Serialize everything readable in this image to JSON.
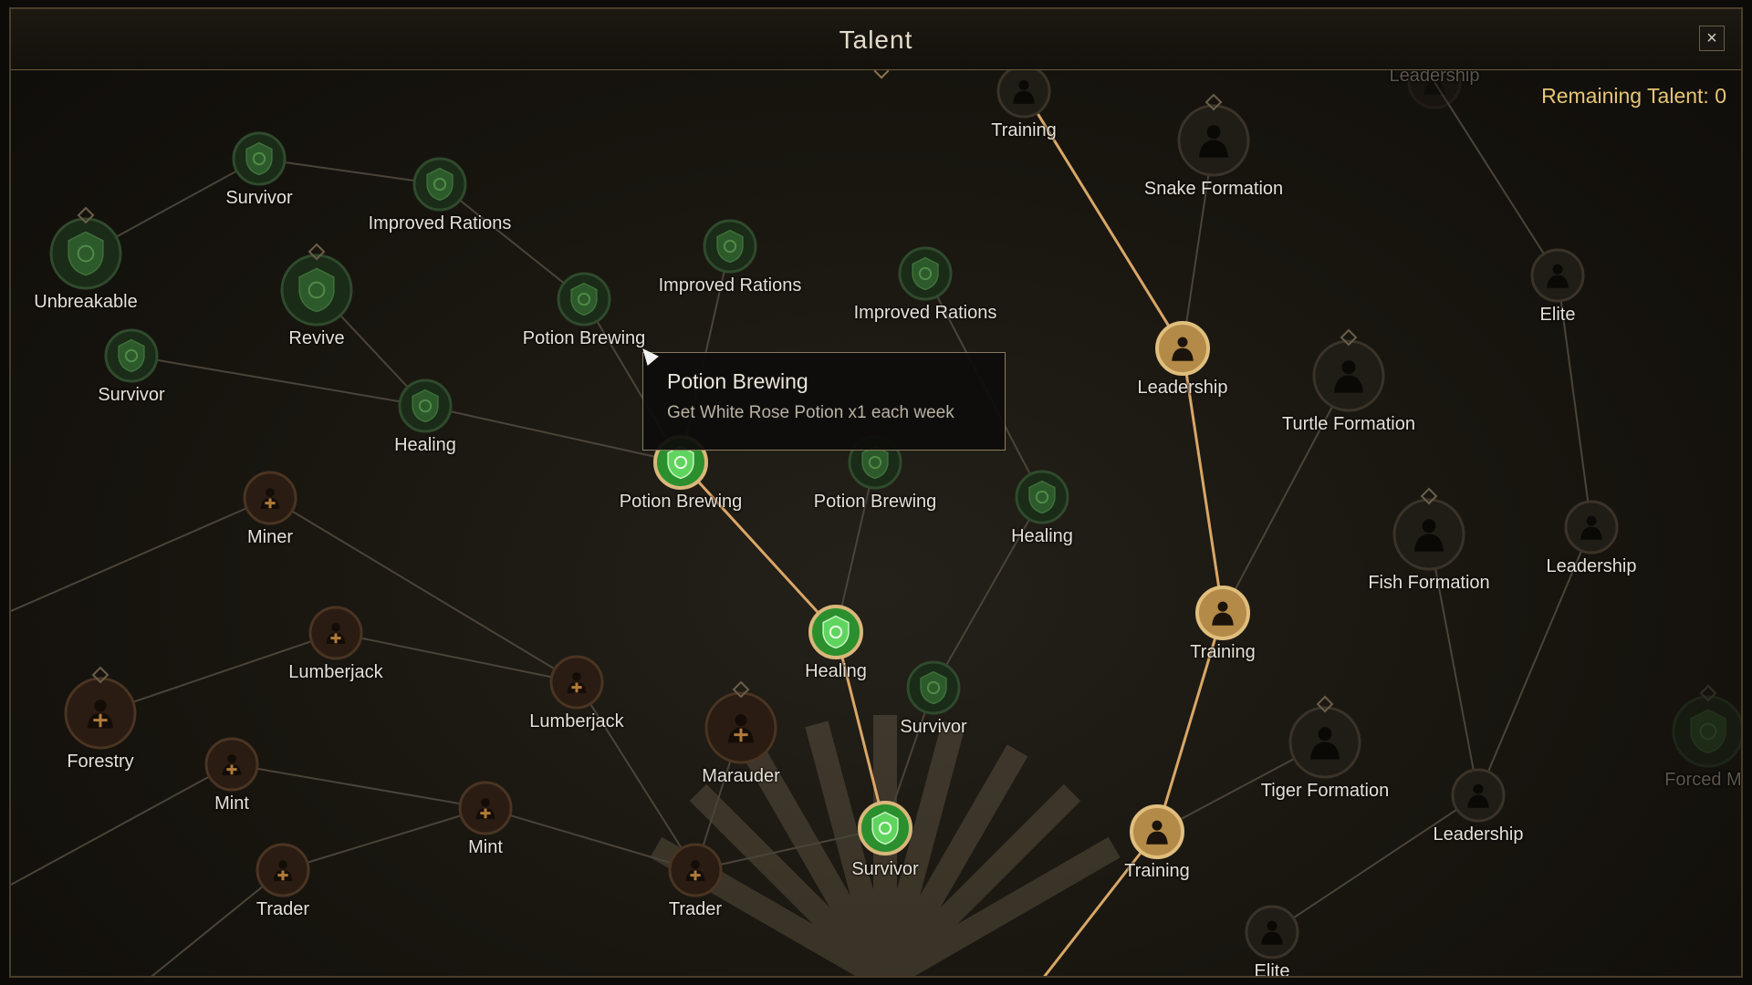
{
  "window": {
    "title": "Talent",
    "close_label": "×",
    "remaining_talent": "Remaining Talent: 0"
  },
  "tooltip": {
    "title": "Potion Brewing",
    "description": "Get White Rose Potion x1 each week"
  },
  "colors": {
    "active_path": "#d9a766",
    "inactive_path": "#4a4438",
    "shield_node": "#3aa83f",
    "figure_node_gold": "#c8a45e",
    "figure_node_bronze": "#6a4a2e"
  },
  "nodes": [
    {
      "id": "survivor-1",
      "label": "Survivor",
      "icon": "shield-icon",
      "state": "available"
    },
    {
      "id": "improved-rations-1",
      "label": "Improved Rations",
      "icon": "shield-icon",
      "state": "available"
    },
    {
      "id": "unbreakable",
      "label": "Unbreakable",
      "icon": "shield-icon",
      "state": "available"
    },
    {
      "id": "revive",
      "label": "Revive",
      "icon": "shield-icon",
      "state": "available"
    },
    {
      "id": "survivor-2",
      "label": "Survivor",
      "icon": "shield-icon",
      "state": "available"
    },
    {
      "id": "healing-1",
      "label": "Healing",
      "icon": "shield-icon",
      "state": "available"
    },
    {
      "id": "potion-brewing-1",
      "label": "Potion Brewing",
      "icon": "shield-icon",
      "state": "available"
    },
    {
      "id": "improved-rations-2",
      "label": "Improved Rations",
      "icon": "shield-icon",
      "state": "available"
    },
    {
      "id": "improved-rations-3",
      "label": "Improved Rations",
      "icon": "shield-icon",
      "state": "available"
    },
    {
      "id": "potion-brewing-2",
      "label": "Potion Brewing",
      "icon": "shield-icon",
      "state": "learned"
    },
    {
      "id": "potion-brewing-3",
      "label": "Potion Brewing",
      "icon": "shield-icon",
      "state": "available"
    },
    {
      "id": "healing-2",
      "label": "Healing",
      "icon": "shield-icon",
      "state": "available"
    },
    {
      "id": "healing-3",
      "label": "Healing",
      "icon": "shield-icon",
      "state": "learned"
    },
    {
      "id": "survivor-3",
      "label": "Survivor",
      "icon": "shield-icon",
      "state": "available"
    },
    {
      "id": "survivor-4",
      "label": "Survivor",
      "icon": "shield-icon",
      "state": "learned"
    },
    {
      "id": "miner",
      "label": "Miner",
      "icon": "worker-icon",
      "state": "available"
    },
    {
      "id": "lumberjack-1",
      "label": "Lumberjack",
      "icon": "worker-icon",
      "state": "available"
    },
    {
      "id": "lumberjack-2",
      "label": "Lumberjack",
      "icon": "worker-icon",
      "state": "available"
    },
    {
      "id": "forestry",
      "label": "Forestry",
      "icon": "worker-icon",
      "state": "available"
    },
    {
      "id": "mint-1",
      "label": "Mint",
      "icon": "worker-icon",
      "state": "available"
    },
    {
      "id": "mint-2",
      "label": "Mint",
      "icon": "worker-icon",
      "state": "available"
    },
    {
      "id": "marauder",
      "label": "Marauder",
      "icon": "worker-icon",
      "state": "available"
    },
    {
      "id": "trader-1",
      "label": "Trader",
      "icon": "worker-icon",
      "state": "available"
    },
    {
      "id": "trader-2",
      "label": "Trader",
      "icon": "worker-icon",
      "state": "available"
    },
    {
      "id": "training-1",
      "label": "Training",
      "icon": "soldier-icon",
      "state": "available"
    },
    {
      "id": "snake-formation",
      "label": "Snake Formation",
      "icon": "soldier-icon",
      "state": "available"
    },
    {
      "id": "leadership-1",
      "label": "Leadership",
      "icon": "soldier-icon",
      "state": "learned"
    },
    {
      "id": "turtle-formation",
      "label": "Turtle Formation",
      "icon": "soldier-icon",
      "state": "available"
    },
    {
      "id": "training-2",
      "label": "Training",
      "icon": "soldier-icon",
      "state": "learned"
    },
    {
      "id": "fish-formation",
      "label": "Fish Formation",
      "icon": "soldier-icon",
      "state": "available"
    },
    {
      "id": "training-3",
      "label": "Training",
      "icon": "soldier-icon",
      "state": "learned"
    },
    {
      "id": "tiger-formation",
      "label": "Tiger Formation",
      "icon": "soldier-icon",
      "state": "available"
    },
    {
      "id": "elite-1",
      "label": "Elite",
      "icon": "soldier-icon",
      "state": "available"
    },
    {
      "id": "leadership-2",
      "label": "Leadership",
      "icon": "soldier-icon",
      "state": "available"
    },
    {
      "id": "leadership-3",
      "label": "Leadership",
      "icon": "soldier-icon",
      "state": "available"
    },
    {
      "id": "leadership-4",
      "label": "Leadership",
      "icon": "soldier-icon",
      "state": "faded"
    },
    {
      "id": "elite-2",
      "label": "Elite",
      "icon": "soldier-icon",
      "state": "available"
    },
    {
      "id": "forced-march",
      "label": "Forced Ma",
      "icon": "shield-icon",
      "state": "faded"
    }
  ]
}
